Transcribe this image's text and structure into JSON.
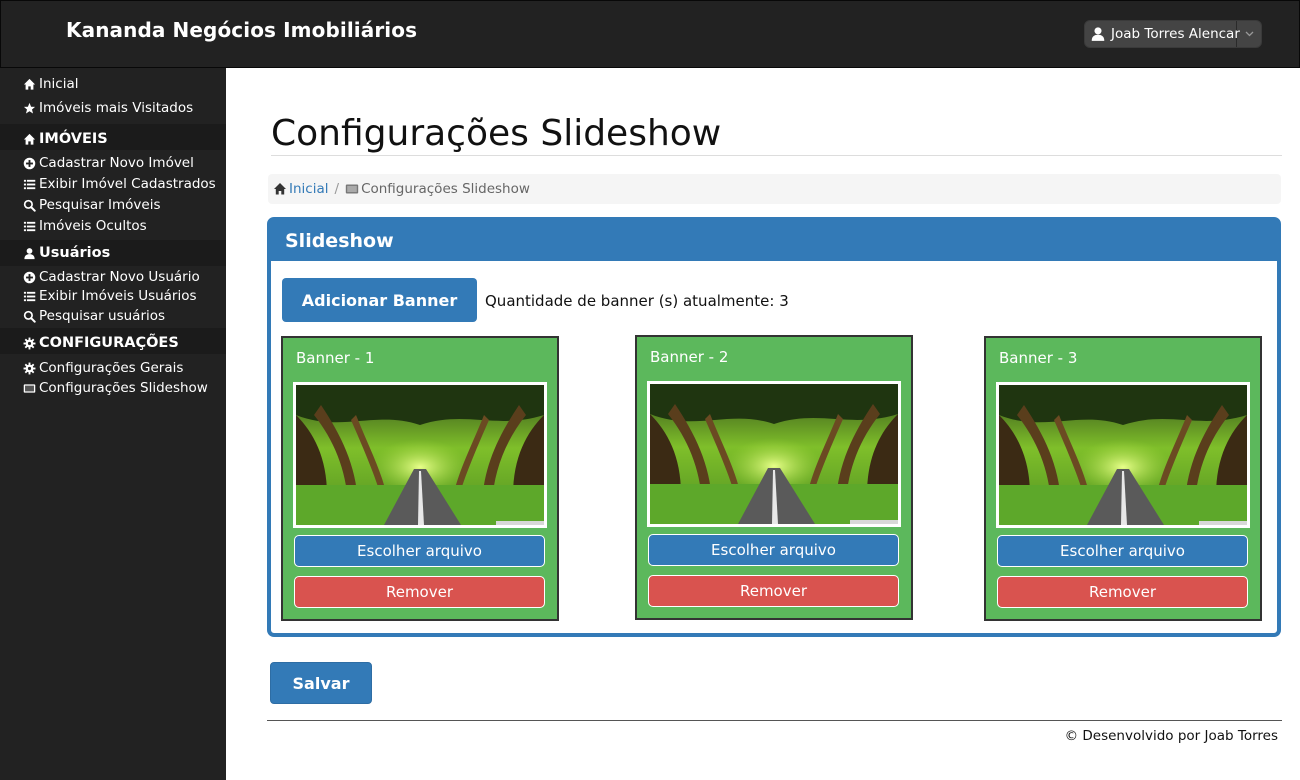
{
  "app": {
    "brand": "Kananda Negócios Imobiliários",
    "user_name": "Joab Torres Alencar"
  },
  "sidebar": {
    "top_items": [
      {
        "label": "Inicial",
        "icon": "home-icon"
      },
      {
        "label": "Imóveis mais Visitados",
        "icon": "star-icon"
      }
    ],
    "sections": [
      {
        "title": "IMÓVEIS",
        "icon": "home-icon",
        "items": [
          {
            "label": "Cadastrar Novo Imóvel",
            "icon": "plus-circle-icon"
          },
          {
            "label": "Exibir Imóvel Cadastrados",
            "icon": "list-icon"
          },
          {
            "label": "Pesquisar Imóveis",
            "icon": "search-icon"
          },
          {
            "label": "Imóveis Ocultos",
            "icon": "list-icon"
          }
        ]
      },
      {
        "title": "Usuários",
        "icon": "user-icon",
        "items": [
          {
            "label": "Cadastrar Novo Usuário",
            "icon": "plus-circle-icon"
          },
          {
            "label": "Exibir Imóveis Usuários",
            "icon": "list-icon"
          },
          {
            "label": "Pesquisar usuários",
            "icon": "search-icon"
          }
        ]
      },
      {
        "title": "CONFIGURAÇÕES",
        "icon": "gear-icon",
        "items": [
          {
            "label": "Configurações Gerais",
            "icon": "gears-icon"
          },
          {
            "label": "Configurações Slideshow",
            "icon": "slideshow-icon"
          }
        ]
      }
    ]
  },
  "page": {
    "title": "Configurações Slideshow",
    "breadcrumb": {
      "home": "Inicial",
      "separator": "/",
      "current": "Configurações Slideshow"
    }
  },
  "panel": {
    "title": "Slideshow",
    "add_button": "Adicionar Banner",
    "quantity_text": "Quantidade de banner (s) atualmente: 3",
    "banners": [
      {
        "title": "Banner - 1",
        "choose_file": "Escolher arquivo",
        "remove": "Remover"
      },
      {
        "title": "Banner - 2",
        "choose_file": "Escolher arquivo",
        "remove": "Remover"
      },
      {
        "title": "Banner - 3",
        "choose_file": "Escolher arquivo",
        "remove": "Remover"
      }
    ]
  },
  "actions": {
    "save": "Salvar"
  },
  "footer": {
    "text": "© Desenvolvido por Joab Torres"
  },
  "colors": {
    "primary": "#337ab7",
    "success": "#5cb85c",
    "danger": "#d9534f",
    "navbar": "#222222"
  }
}
